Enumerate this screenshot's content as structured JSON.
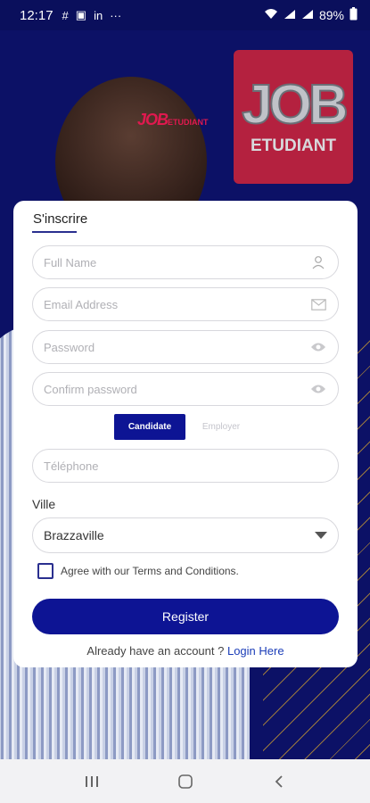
{
  "status_bar": {
    "time": "12:17",
    "notifications": [
      "#",
      "▣",
      "in",
      "···"
    ],
    "battery": "89%"
  },
  "logos": {
    "small_main": "JOB",
    "small_sub": "ETUDIANT",
    "box_main": "JOB",
    "box_sub": "ETUDIANT"
  },
  "form": {
    "title": "S'inscrire",
    "full_name_placeholder": "Full Name",
    "email_placeholder": "Email Address",
    "password_placeholder": "Password",
    "confirm_password_placeholder": "Confirm password",
    "role_tabs": [
      "Candidate",
      "Employer"
    ],
    "phone_placeholder": "Téléphone",
    "city_label": "Ville",
    "city_value": "Brazzaville",
    "agree_text": "Agree with our Terms and Conditions.",
    "register_label": "Register",
    "already_text": "Already have an account ? ",
    "login_link": "Login Here"
  },
  "colors": {
    "accent": "#0d1494",
    "background": "#0c1166",
    "logo_red": "#b4213f"
  }
}
